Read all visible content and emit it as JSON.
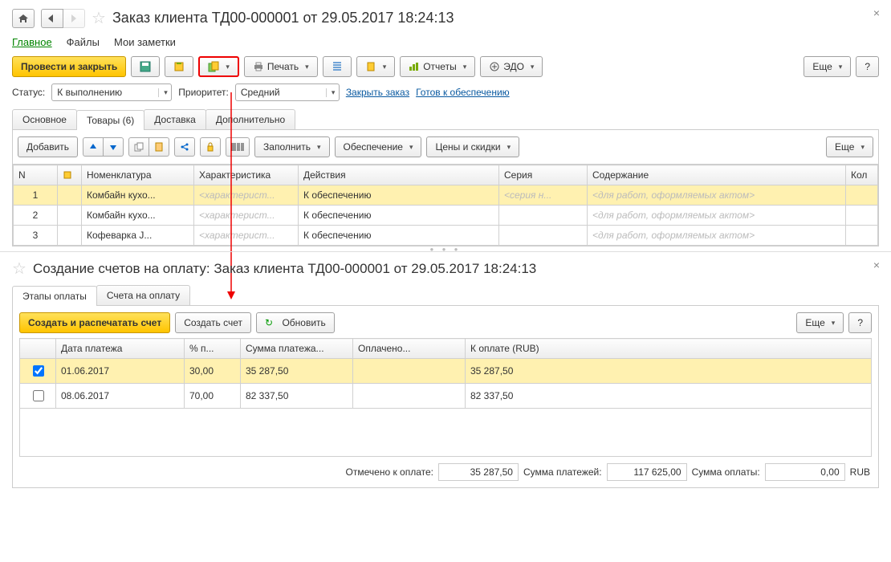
{
  "top": {
    "title": "Заказ клиента ТД00-000001 от 29.05.2017 18:24:13",
    "sections": [
      "Главное",
      "Файлы",
      "Мои заметки"
    ],
    "active_section": 0,
    "toolbar": {
      "post_close": "Провести и закрыть",
      "print": "Печать",
      "reports": "Отчеты",
      "edo": "ЭДО",
      "more": "Еще"
    },
    "form": {
      "status_label": "Статус:",
      "status_value": "К выполнению",
      "priority_label": "Приоритет:",
      "priority_value": "Средний",
      "close_order": "Закрыть заказ",
      "ready_supply": "Готов к обеспечению"
    },
    "inner_tabs": [
      "Основное",
      "Товары (6)",
      "Доставка",
      "Дополнительно"
    ],
    "active_inner": 1,
    "subtoolbar": {
      "add": "Добавить",
      "fill": "Заполнить",
      "supply": "Обеспечение",
      "prices": "Цены и скидки",
      "more": "Еще"
    },
    "goods": {
      "headers": {
        "n": "N",
        "item": "Номенклатура",
        "char": "Характеристика",
        "act": "Действия",
        "ser": "Серия",
        "cont": "Содержание",
        "qty": "Кол"
      },
      "rows": [
        {
          "n": "1",
          "item": "Комбайн кухо...",
          "char": "<характерист...",
          "act": "К обеспечению",
          "ser": "<серия н...",
          "cont": "<для работ, оформляемых актом>",
          "sel": true
        },
        {
          "n": "2",
          "item": "Комбайн кухо...",
          "char": "<характерист...",
          "act": "К обеспечению",
          "ser": "",
          "cont": "<для работ, оформляемых актом>",
          "sel": false
        },
        {
          "n": "3",
          "item": "Кофеварка J...",
          "char": "<характерист...",
          "act": "К обеспечению",
          "ser": "",
          "cont": "<для работ, оформляемых актом>",
          "sel": false
        }
      ]
    }
  },
  "bottom": {
    "title": "Создание счетов на оплату: Заказ клиента ТД00-000001 от 29.05.2017 18:24:13",
    "tabs": [
      "Этапы оплаты",
      "Счета на оплату"
    ],
    "active_tab": 0,
    "toolbar": {
      "create_print": "Создать и распечатать счет",
      "create": "Создать счет",
      "refresh": "Обновить",
      "more": "Еще"
    },
    "pay": {
      "headers": {
        "date": "Дата платежа",
        "pct": "% п...",
        "sum": "Сумма платежа...",
        "paid": "Оплачено...",
        "topay": "К оплате (RUB)"
      },
      "rows": [
        {
          "chk": true,
          "date": "01.06.2017",
          "pct": "30,00",
          "sum": "35 287,50",
          "paid": "",
          "topay": "35 287,50",
          "sel": true
        },
        {
          "chk": false,
          "date": "08.06.2017",
          "pct": "70,00",
          "sum": "82 337,50",
          "paid": "",
          "topay": "82 337,50",
          "sel": false
        }
      ]
    },
    "totals": {
      "marked_label": "Отмечено к оплате:",
      "marked": "35 287,50",
      "sumpay_label": "Сумма платежей:",
      "sumpay": "117 625,00",
      "sumamt_label": "Сумма оплаты:",
      "sumamt": "0,00",
      "curr": "RUB"
    }
  }
}
